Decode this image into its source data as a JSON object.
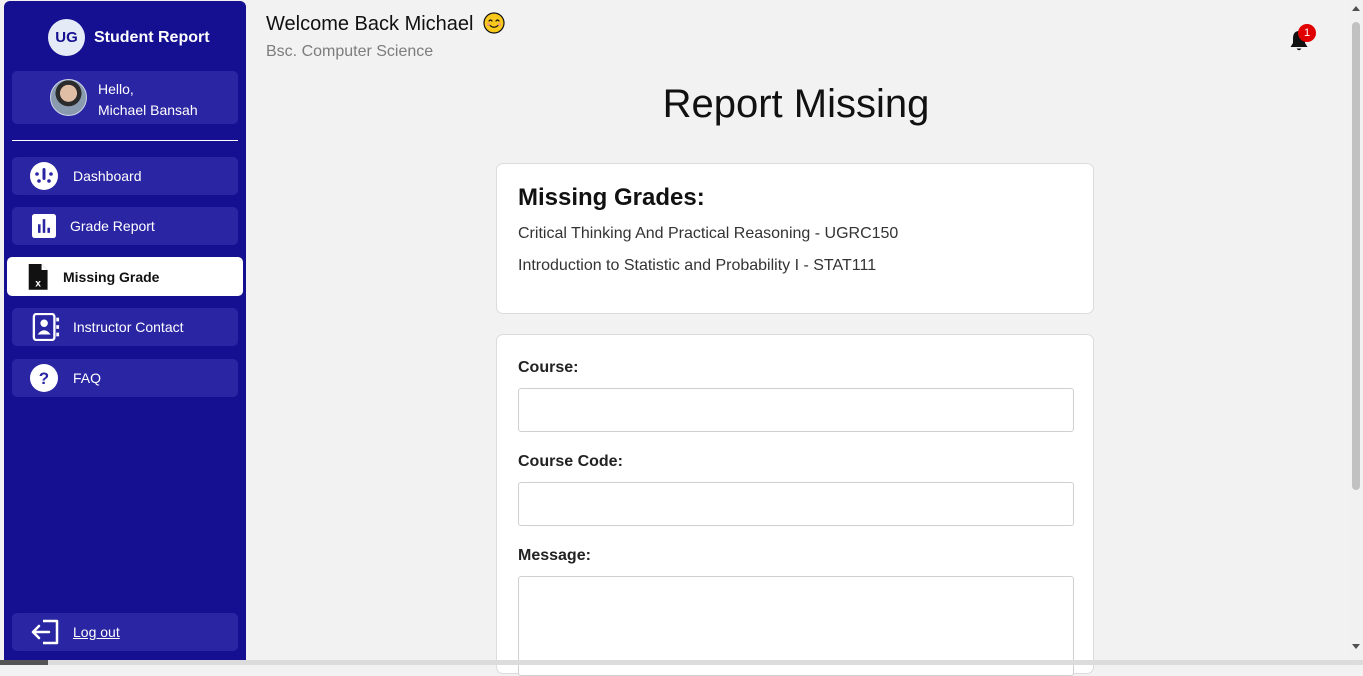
{
  "brand": {
    "logo_text": "UG",
    "name": "Student Report"
  },
  "user": {
    "greeting": "Hello,",
    "name": "Michael Bansah"
  },
  "nav": {
    "items": [
      {
        "label": "Dashboard",
        "icon": "dashboard-gauge-icon"
      },
      {
        "label": "Grade Report",
        "icon": "bar-chart-icon"
      },
      {
        "label": "Missing Grade",
        "icon": "file-x-icon",
        "active": true
      },
      {
        "label": "Instructor Contact",
        "icon": "contact-book-icon"
      },
      {
        "label": "FAQ",
        "icon": "question-circle-icon"
      }
    ],
    "logout_label": "Log out"
  },
  "header": {
    "welcome": "Welcome Back Michael",
    "program": "Bsc. Computer Science",
    "notification_count": "1"
  },
  "page": {
    "title": "Report Missing"
  },
  "missing_grades": {
    "title": "Missing Grades:",
    "items": [
      "Critical Thinking And Practical Reasoning - UGRC150",
      "Introduction to Statistic and Probability I - STAT111"
    ]
  },
  "form": {
    "course_label": "Course:",
    "course_value": "",
    "course_code_label": "Course Code:",
    "course_code_value": "",
    "message_label": "Message:",
    "message_value": ""
  },
  "colors": {
    "sidebar_bg": "#150f91",
    "nav_item_bg": "#2a25a3",
    "badge": "#e00000"
  }
}
